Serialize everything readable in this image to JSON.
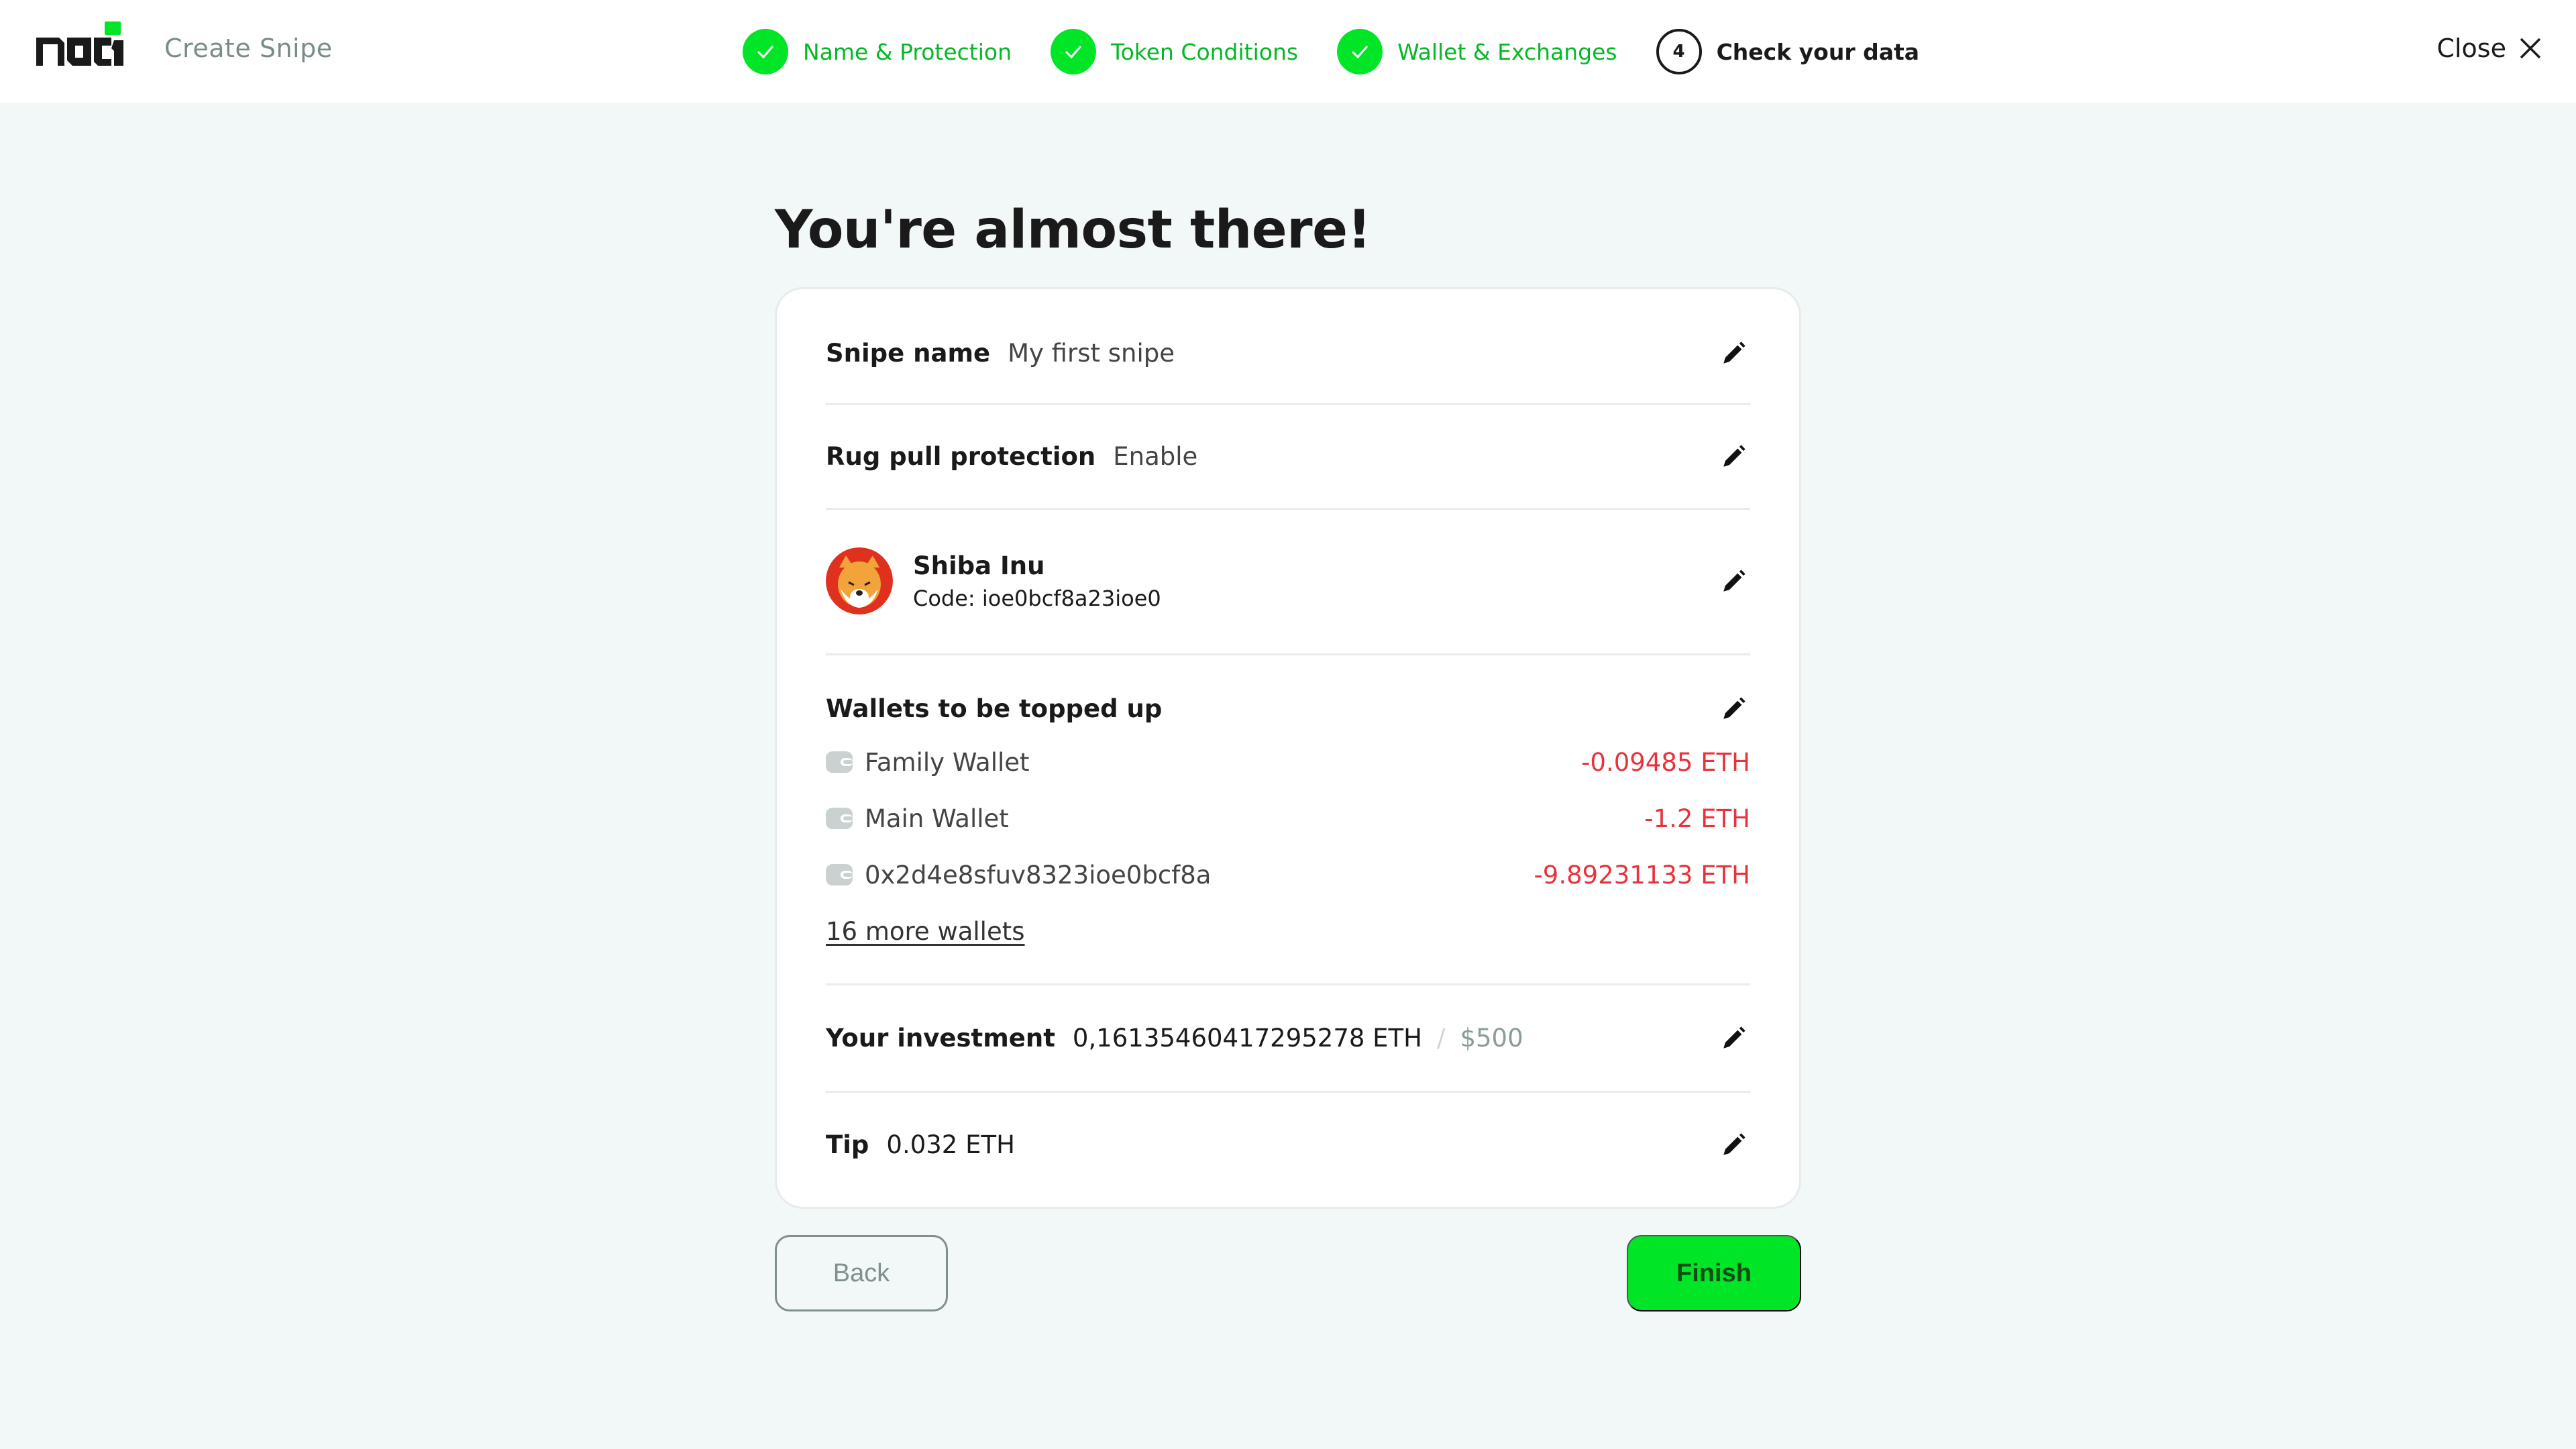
{
  "header": {
    "app_title": "Create Snipe",
    "logo_icon": "noti-logo",
    "steps": [
      {
        "label": "Name & Protection",
        "state": "done",
        "icon": "check-icon"
      },
      {
        "label": "Token Conditions",
        "state": "done",
        "icon": "check-icon"
      },
      {
        "label": "Wallet & Exchanges",
        "state": "done",
        "icon": "check-icon"
      },
      {
        "label": "Check your data",
        "state": "current",
        "number": "4"
      }
    ],
    "close_label": "Close",
    "close_icon": "close-icon"
  },
  "main": {
    "title": "You're almost there!",
    "snipe_name": {
      "label": "Snipe name",
      "value": "My first snipe"
    },
    "rug_pull": {
      "label": "Rug pull protection",
      "value": "Enable"
    },
    "token": {
      "name": "Shiba Inu",
      "code": "Code: ioe0bcf8a23ioe0"
    },
    "wallets": {
      "label": "Wallets to be topped up",
      "items": [
        {
          "name": "Family Wallet",
          "amount": "-0.09485 ETH"
        },
        {
          "name": "Main Wallet",
          "amount": "-1.2 ETH"
        },
        {
          "name": "0x2d4e8sfuv8323ioe0bcf8a",
          "amount": "-9.89231133 ETH"
        }
      ],
      "more_link": "16 more wallets"
    },
    "investment": {
      "label": "Your investment",
      "eth": "0,16135460417295278 ETH",
      "separator": "/",
      "usd": "$500"
    },
    "tip": {
      "label": "Tip",
      "value": "0.032 ETH"
    }
  },
  "footer": {
    "back_label": "Back",
    "finish_label": "Finish"
  },
  "colors": {
    "accent_green": "#00e626",
    "negative_red": "#e8323c",
    "background": "#f2f7f7"
  }
}
